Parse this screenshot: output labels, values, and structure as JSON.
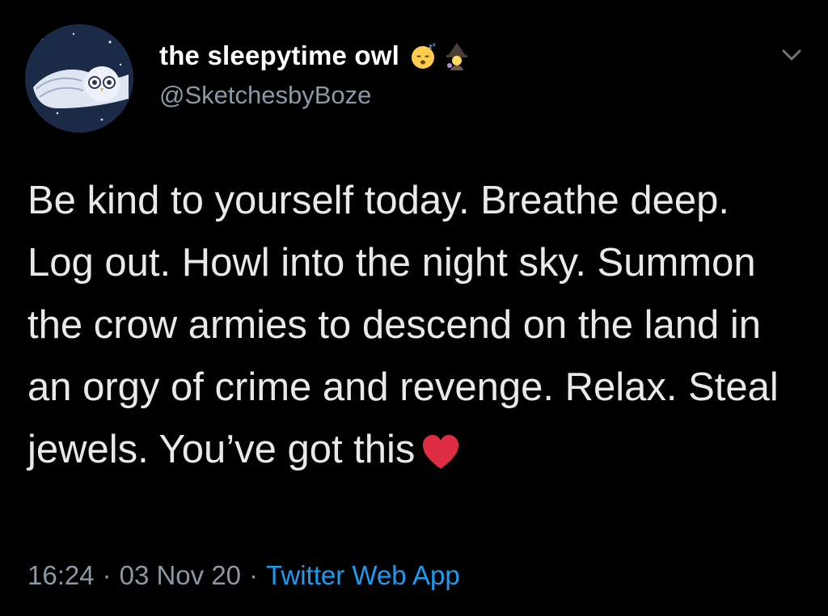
{
  "author": {
    "display_name": "the sleepytime owl",
    "handle": "@SketchesbyBoze",
    "name_emojis": [
      "sleeping-face-emoji",
      "mage-emoji"
    ]
  },
  "tweet": {
    "text": "Be kind to yourself today. Breathe deep. Log out. Howl into the night sky. Summon the crow armies to descend on the land in an orgy of crime and revenge. Relax. Steal jewels. You’ve got this",
    "trailing_emoji": "red-heart-emoji"
  },
  "meta": {
    "time": "16:24",
    "separator": "·",
    "date": "03 Nov 20",
    "source": "Twitter Web App"
  },
  "colors": {
    "background": "#000000",
    "text": "#e7e9ea",
    "secondary": "#8b98a5",
    "link": "#1d9bf0"
  }
}
